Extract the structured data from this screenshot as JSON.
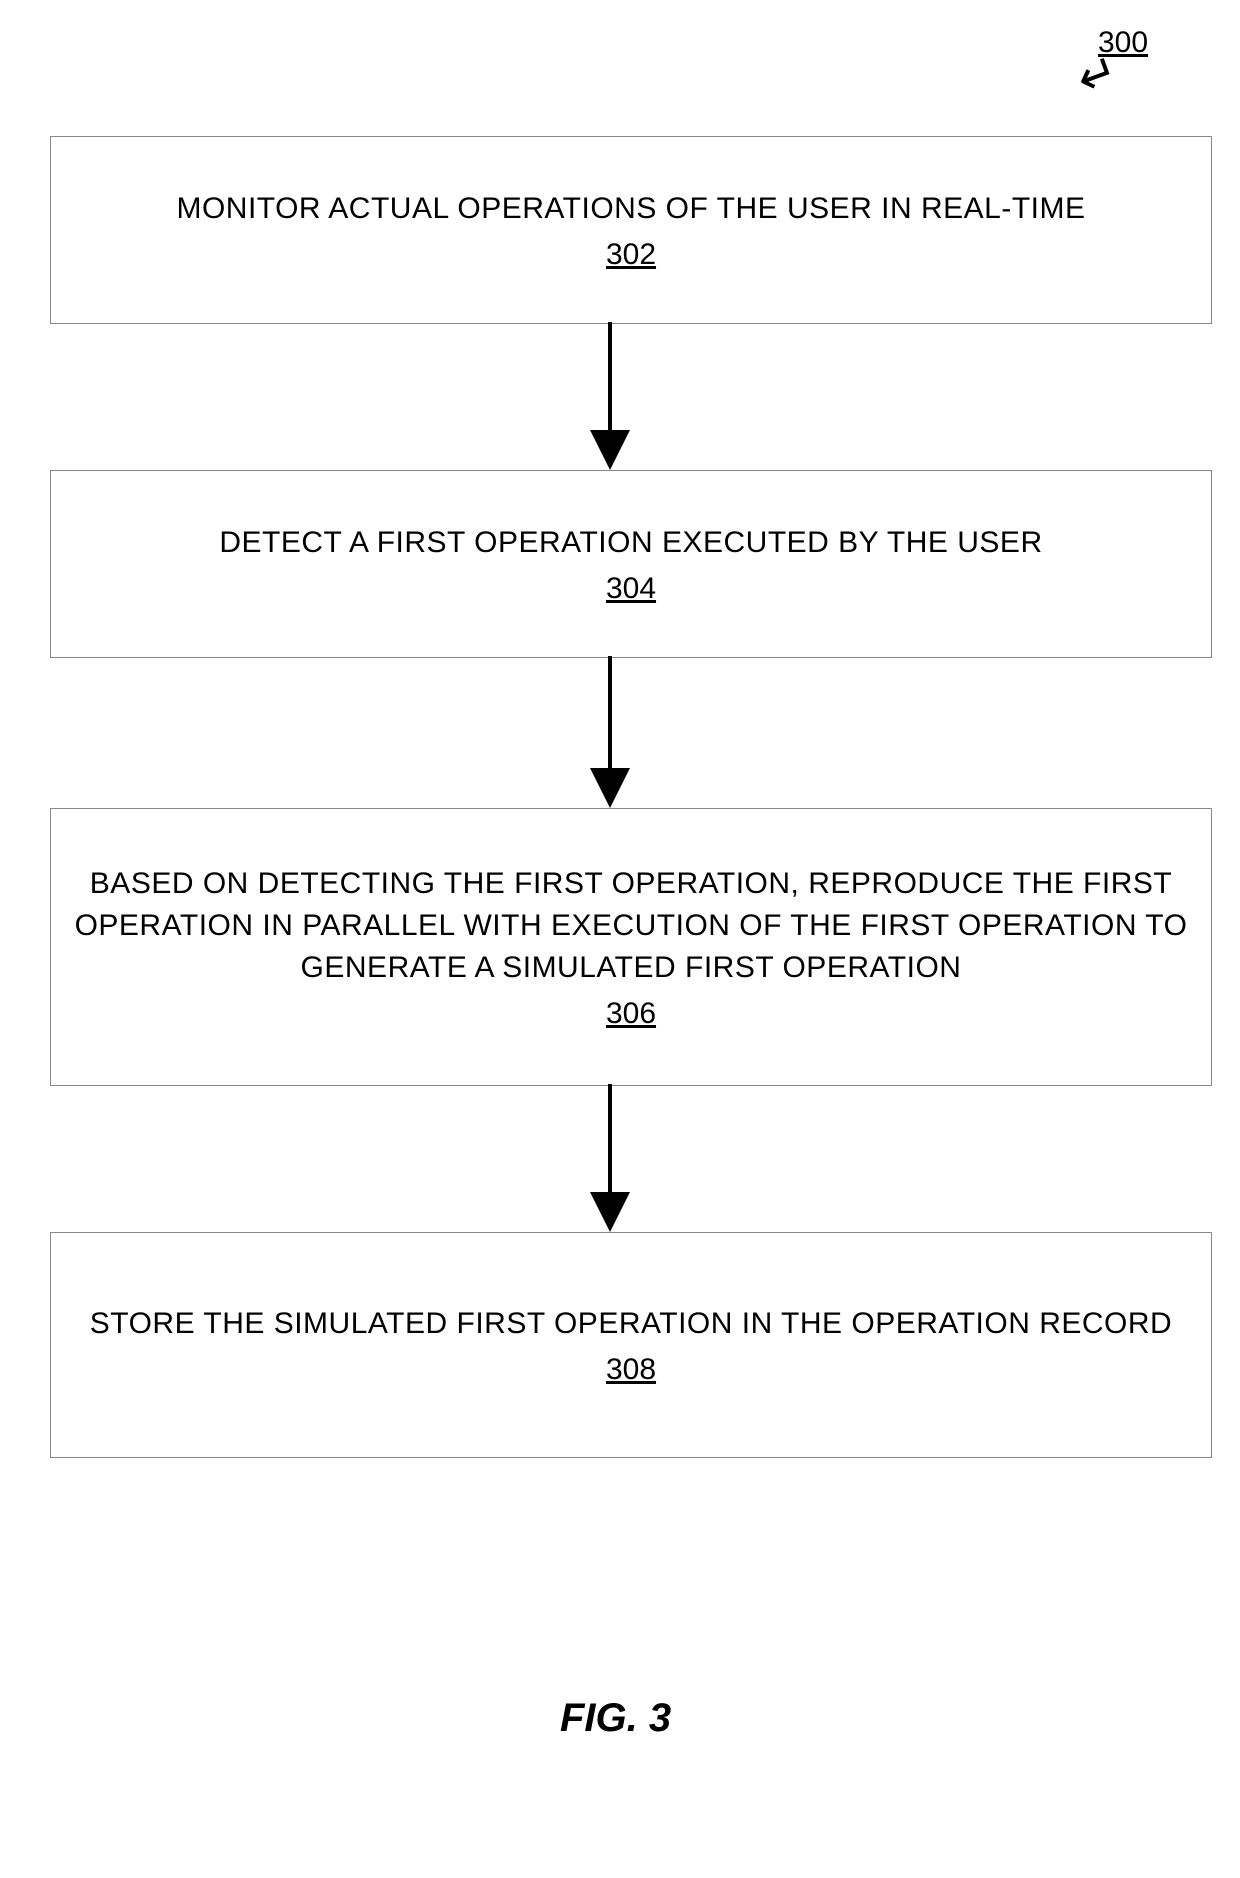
{
  "figure": {
    "ref_number": "300",
    "caption": "FIG. 3"
  },
  "steps": {
    "s302": {
      "text": "MONITOR ACTUAL OPERATIONS OF THE USER IN REAL-TIME",
      "num": "302"
    },
    "s304": {
      "text": "DETECT A FIRST OPERATION EXECUTED BY THE USER",
      "num": "304"
    },
    "s306": {
      "text": "BASED ON DETECTING THE FIRST OPERATION, REPRODUCE THE FIRST OPERATION IN PARALLEL WITH EXECUTION OF THE FIRST OPERATION TO GENERATE A SIMULATED FIRST OPERATION",
      "num": "306"
    },
    "s308": {
      "text": "STORE THE SIMULATED FIRST OPERATION IN THE OPERATION RECORD",
      "num": "308"
    }
  }
}
